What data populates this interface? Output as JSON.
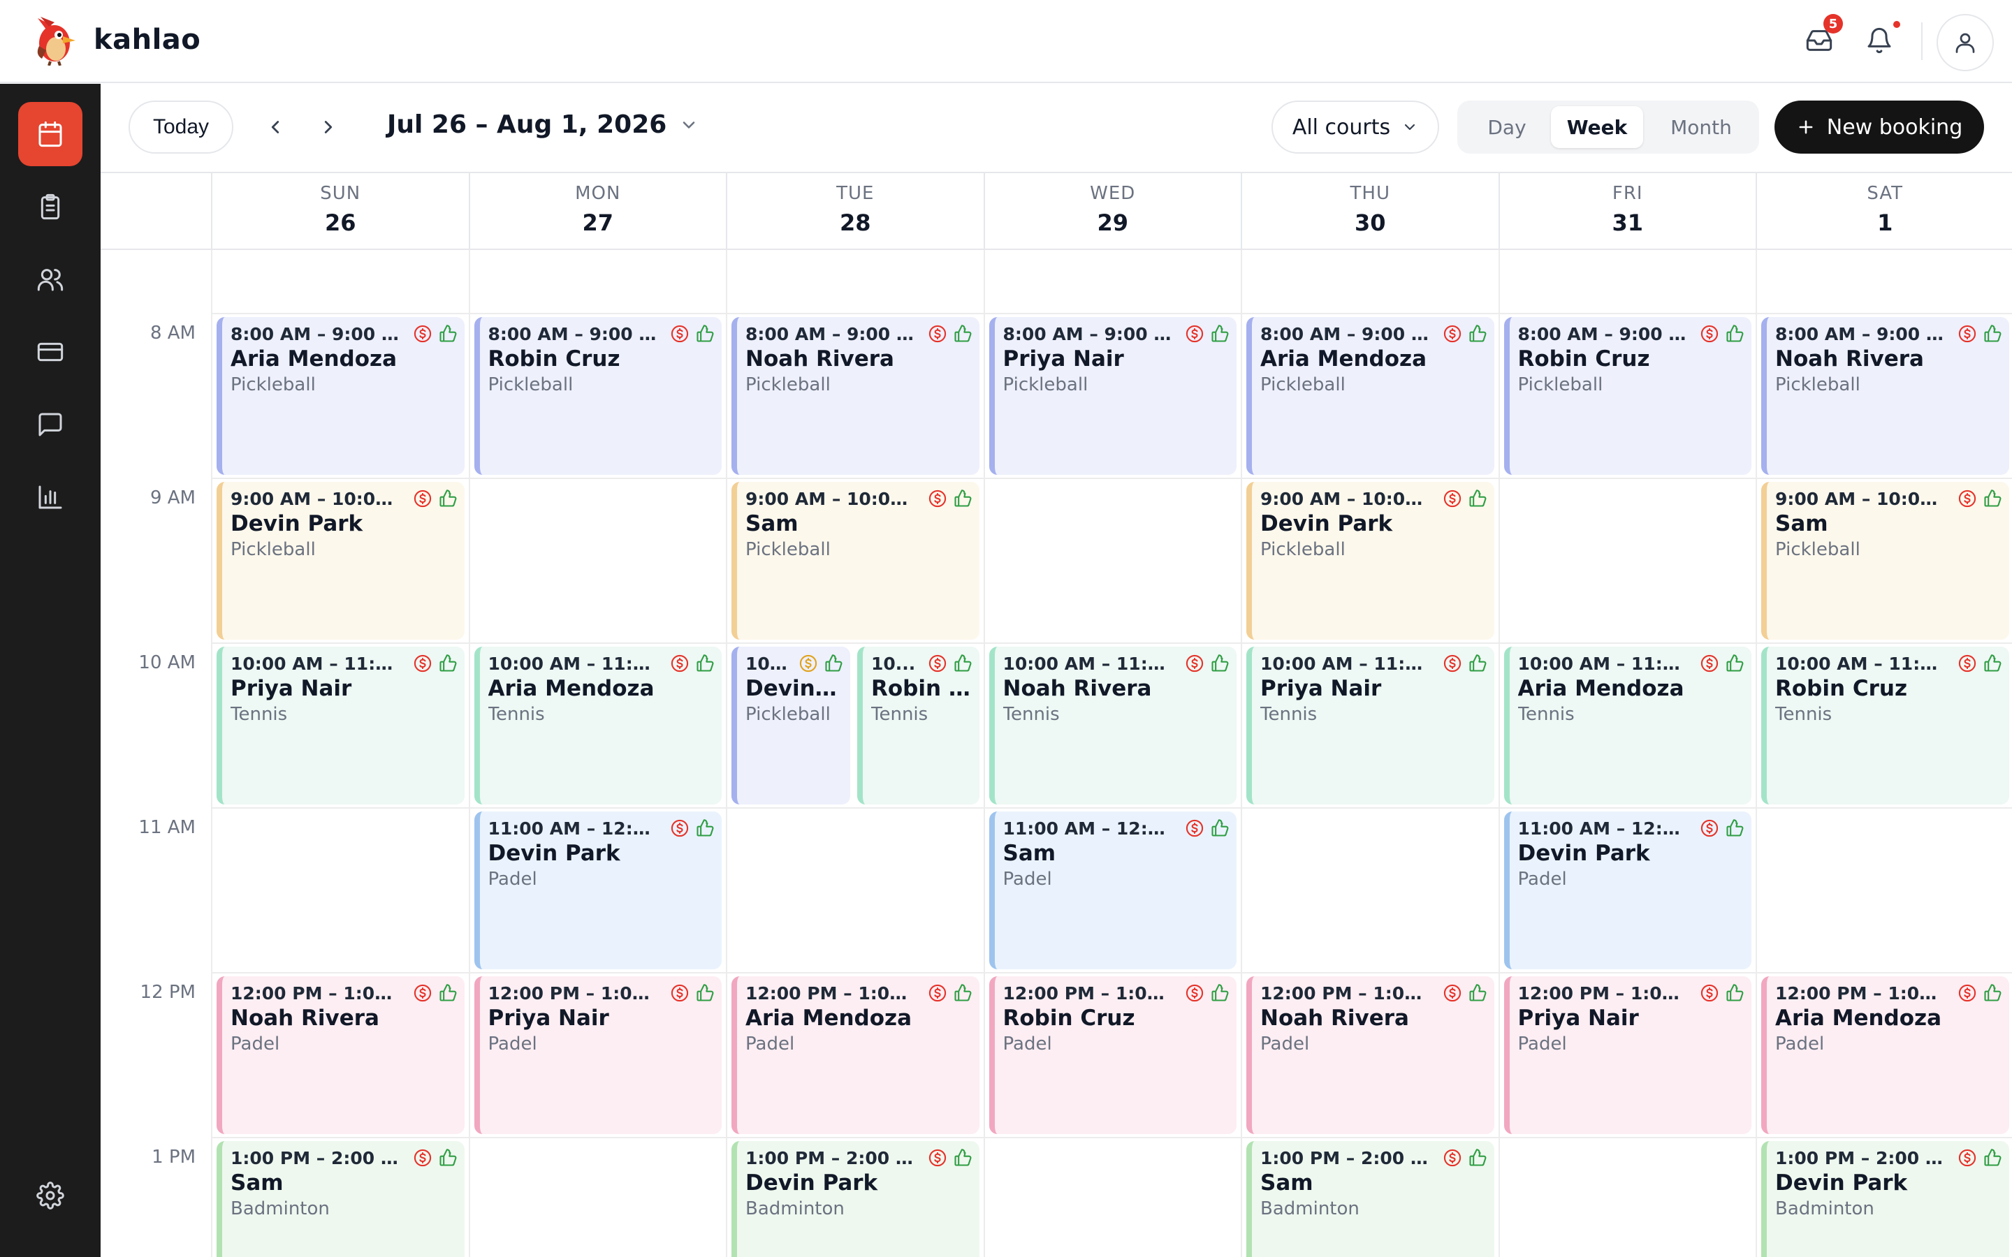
{
  "app": {
    "brand": "kahlao",
    "inbox_badge": "5"
  },
  "toolbar": {
    "today": "Today",
    "range": "Jul 26 – Aug 1, 2026",
    "courts": "All courts",
    "views": [
      "Day",
      "Week",
      "Month"
    ],
    "active_view": "Week",
    "new_booking": "New booking"
  },
  "sidebar": {
    "items": [
      "calendar",
      "bookings",
      "members",
      "payments",
      "messages",
      "reports"
    ],
    "active": "calendar"
  },
  "days": [
    {
      "dow": "SUN",
      "num": "26"
    },
    {
      "dow": "MON",
      "num": "27"
    },
    {
      "dow": "TUE",
      "num": "28"
    },
    {
      "dow": "WED",
      "num": "29"
    },
    {
      "dow": "THU",
      "num": "30"
    },
    {
      "dow": "FRI",
      "num": "31"
    },
    {
      "dow": "SAT",
      "num": "1"
    }
  ],
  "hours": [
    "8 AM",
    "9 AM",
    "10 AM",
    "11 AM",
    "12 PM",
    "1 PM"
  ],
  "colors": {
    "accent": "#e6452f",
    "pickleball_am": "#a5b0ee",
    "pickleball_mid": "#f2cf95",
    "tennis": "#a3e4c8",
    "padel_am": "#9ec4ee",
    "padel_pm": "#f1a7c0",
    "badminton": "#b2e2b2",
    "paid_icon": "#e5332a",
    "pending_icon": "#e0a21b",
    "confirmed_icon": "#2f9e44"
  },
  "events": [
    {
      "day": 0,
      "slot": 0,
      "color": "blue",
      "time": "8:00 AM – 9:00 AM",
      "name": "Aria Mendoza",
      "sport": "Pickleball",
      "pay": "paid"
    },
    {
      "day": 1,
      "slot": 0,
      "color": "blue",
      "time": "8:00 AM – 9:00 AM",
      "name": "Robin Cruz",
      "sport": "Pickleball",
      "pay": "paid"
    },
    {
      "day": 2,
      "slot": 0,
      "color": "blue",
      "time": "8:00 AM – 9:00 AM",
      "name": "Noah Rivera",
      "sport": "Pickleball",
      "pay": "paid"
    },
    {
      "day": 3,
      "slot": 0,
      "color": "blue",
      "time": "8:00 AM – 9:00 AM",
      "name": "Priya Nair",
      "sport": "Pickleball",
      "pay": "paid"
    },
    {
      "day": 4,
      "slot": 0,
      "color": "blue",
      "time": "8:00 AM – 9:00 AM",
      "name": "Aria Mendoza",
      "sport": "Pickleball",
      "pay": "paid"
    },
    {
      "day": 5,
      "slot": 0,
      "color": "blue",
      "time": "8:00 AM – 9:00 AM",
      "name": "Robin Cruz",
      "sport": "Pickleball",
      "pay": "paid"
    },
    {
      "day": 6,
      "slot": 0,
      "color": "blue",
      "time": "8:00 AM – 9:00 AM",
      "name": "Noah Rivera",
      "sport": "Pickleball",
      "pay": "paid"
    },
    {
      "day": 0,
      "slot": 1,
      "color": "orange",
      "time": "9:00 AM – 10:00 A...",
      "name": "Devin Park",
      "sport": "Pickleball",
      "pay": "paid"
    },
    {
      "day": 2,
      "slot": 1,
      "color": "orange",
      "time": "9:00 AM – 10:00 A...",
      "name": "Sam",
      "sport": "Pickleball",
      "pay": "paid"
    },
    {
      "day": 4,
      "slot": 1,
      "color": "orange",
      "time": "9:00 AM – 10:00 A...",
      "name": "Devin Park",
      "sport": "Pickleball",
      "pay": "paid"
    },
    {
      "day": 6,
      "slot": 1,
      "color": "orange",
      "time": "9:00 AM – 10:00 A...",
      "name": "Sam",
      "sport": "Pickleball",
      "pay": "paid"
    },
    {
      "day": 0,
      "slot": 2,
      "color": "green",
      "time": "10:00 AM – 11:00 ...",
      "name": "Priya Nair",
      "sport": "Tennis",
      "pay": "paid"
    },
    {
      "day": 1,
      "slot": 2,
      "color": "green",
      "time": "10:00 AM – 11:00 ...",
      "name": "Aria Mendoza",
      "sport": "Tennis",
      "pay": "paid"
    },
    {
      "day": 2,
      "slot": 2,
      "color": "blue",
      "time": "10...",
      "name": "Devin P...",
      "sport": "Pickleball",
      "pay": "pending",
      "split": "left"
    },
    {
      "day": 2,
      "slot": 2,
      "color": "green",
      "time": "10...",
      "name": "Robin ...",
      "sport": "Tennis",
      "pay": "paid",
      "split": "right"
    },
    {
      "day": 3,
      "slot": 2,
      "color": "green",
      "time": "10:00 AM – 11:00 ...",
      "name": "Noah Rivera",
      "sport": "Tennis",
      "pay": "paid"
    },
    {
      "day": 4,
      "slot": 2,
      "color": "green",
      "time": "10:00 AM – 11:00 ...",
      "name": "Priya Nair",
      "sport": "Tennis",
      "pay": "paid"
    },
    {
      "day": 5,
      "slot": 2,
      "color": "green",
      "time": "10:00 AM – 11:00 ...",
      "name": "Aria Mendoza",
      "sport": "Tennis",
      "pay": "paid"
    },
    {
      "day": 6,
      "slot": 2,
      "color": "green",
      "time": "10:00 AM – 11:00 ...",
      "name": "Robin Cruz",
      "sport": "Tennis",
      "pay": "paid"
    },
    {
      "day": 1,
      "slot": 3,
      "color": "sky",
      "time": "11:00 AM – 12:00 P...",
      "name": "Devin Park",
      "sport": "Padel",
      "pay": "paid"
    },
    {
      "day": 3,
      "slot": 3,
      "color": "sky",
      "time": "11:00 AM – 12:00 P...",
      "name": "Sam",
      "sport": "Padel",
      "pay": "paid"
    },
    {
      "day": 5,
      "slot": 3,
      "color": "sky",
      "time": "11:00 AM – 12:00 P...",
      "name": "Devin Park",
      "sport": "Padel",
      "pay": "paid"
    },
    {
      "day": 0,
      "slot": 4,
      "color": "pink",
      "time": "12:00 PM – 1:00 PM",
      "name": "Noah Rivera",
      "sport": "Padel",
      "pay": "paid"
    },
    {
      "day": 1,
      "slot": 4,
      "color": "pink",
      "time": "12:00 PM – 1:00 PM",
      "name": "Priya Nair",
      "sport": "Padel",
      "pay": "paid"
    },
    {
      "day": 2,
      "slot": 4,
      "color": "pink",
      "time": "12:00 PM – 1:00 PM",
      "name": "Aria Mendoza",
      "sport": "Padel",
      "pay": "paid"
    },
    {
      "day": 3,
      "slot": 4,
      "color": "pink",
      "time": "12:00 PM – 1:00 PM",
      "name": "Robin Cruz",
      "sport": "Padel",
      "pay": "paid"
    },
    {
      "day": 4,
      "slot": 4,
      "color": "pink",
      "time": "12:00 PM – 1:00 PM",
      "name": "Noah Rivera",
      "sport": "Padel",
      "pay": "paid"
    },
    {
      "day": 5,
      "slot": 4,
      "color": "pink",
      "time": "12:00 PM – 1:00 PM",
      "name": "Priya Nair",
      "sport": "Padel",
      "pay": "paid"
    },
    {
      "day": 6,
      "slot": 4,
      "color": "pink",
      "time": "12:00 PM – 1:00 PM",
      "name": "Aria Mendoza",
      "sport": "Padel",
      "pay": "paid"
    },
    {
      "day": 0,
      "slot": 5,
      "color": "lgreen",
      "time": "1:00 PM – 2:00 PM",
      "name": "Sam",
      "sport": "Badminton",
      "pay": "paid"
    },
    {
      "day": 2,
      "slot": 5,
      "color": "lgreen",
      "time": "1:00 PM – 2:00 PM",
      "name": "Devin Park",
      "sport": "Badminton",
      "pay": "paid"
    },
    {
      "day": 4,
      "slot": 5,
      "color": "lgreen",
      "time": "1:00 PM – 2:00 PM",
      "name": "Sam",
      "sport": "Badminton",
      "pay": "paid"
    },
    {
      "day": 6,
      "slot": 5,
      "color": "lgreen",
      "time": "1:00 PM – 2:00 PM",
      "name": "Devin Park",
      "sport": "Badminton",
      "pay": "paid"
    }
  ]
}
